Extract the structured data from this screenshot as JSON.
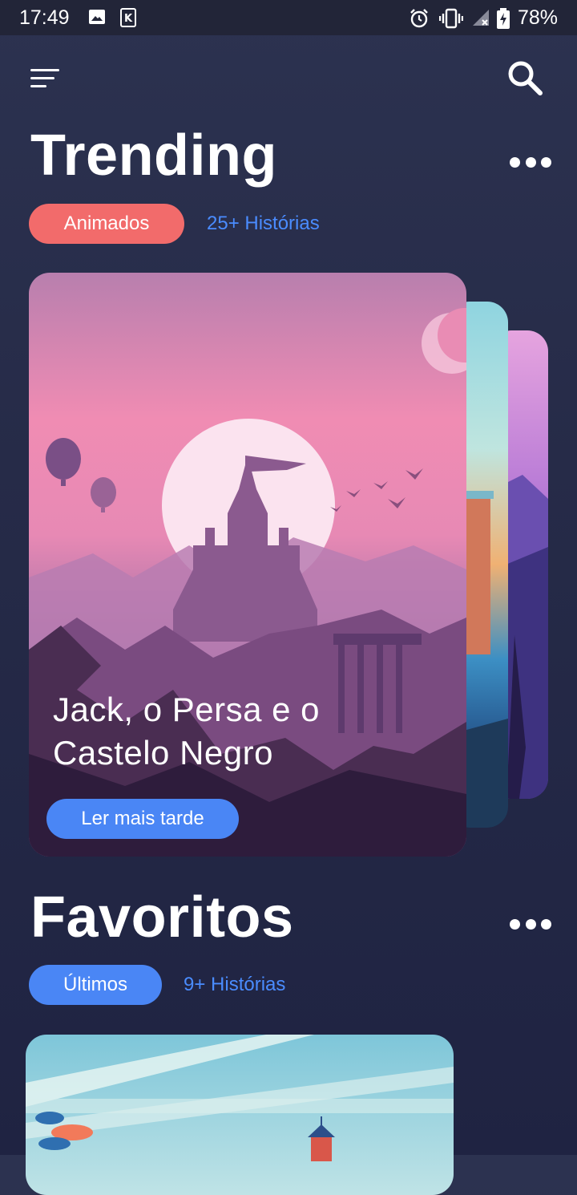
{
  "status_bar": {
    "time": "17:49",
    "battery_percent": "78%",
    "left_icons": [
      "image-icon",
      "k-app-icon"
    ],
    "right_icons": [
      "alarm-icon",
      "vibrate-icon",
      "signal-icon",
      "battery-charging-icon"
    ]
  },
  "header": {
    "menu_icon": "menu-icon",
    "search_icon": "search-icon"
  },
  "trending": {
    "title": "Trending",
    "more_icon": "more-dots-icon",
    "filter_label": "Animados",
    "filter_color": "#f26b6b",
    "count_label": "25+ Histórias",
    "featured": {
      "title_line1": "Jack, o Persa e o",
      "title_line2": "Castelo Negro",
      "button_label": "Ler mais tarde"
    }
  },
  "favorites": {
    "title": "Favoritos",
    "more_icon": "more-dots-icon",
    "filter_label": "Últimos",
    "filter_color": "#4a86f5",
    "count_label": "9+ Histórias"
  },
  "colors": {
    "accent_blue": "#4a8cff",
    "accent_red": "#f26b6b",
    "background": "#262b48"
  }
}
